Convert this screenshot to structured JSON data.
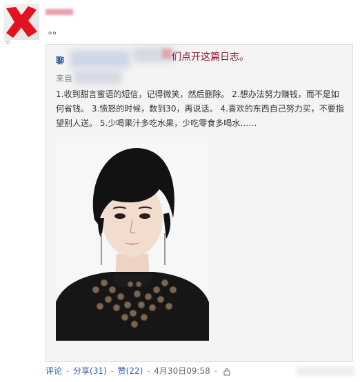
{
  "post": {
    "status_text": "。。"
  },
  "card": {
    "head_label": "聊",
    "head_suffix": "们点开这篇日志。",
    "source_label": "来自",
    "body": "1.收到甜言蜜语的短信，记得微笑，然后删除。 2.想办法努力赚钱，而不是如何省钱。 3.愤怒的时候，数到30，再说话。 4.喜欢的东西自己努力买，不要指望别人送。 5.少喝果汁多吃水果，少吃零食多喝水……"
  },
  "footer": {
    "comment_label": "评论",
    "share_label": "分享(31)",
    "like_label": "赞(22)",
    "timestamp": "4月30日09:58"
  },
  "colors": {
    "link": "#2b5aa9",
    "title_red": "#8a1a2a",
    "card_bg": "#f4f4f4"
  }
}
